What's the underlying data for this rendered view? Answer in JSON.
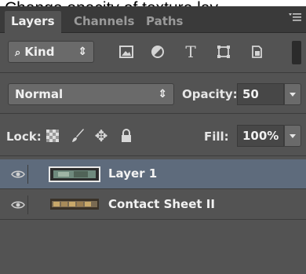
{
  "caption": "Change opacity of texture lay",
  "panel": {
    "tabs": [
      {
        "label": "Layers",
        "active": true
      },
      {
        "label": "Channels",
        "active": false
      },
      {
        "label": "Paths",
        "active": false
      }
    ],
    "menu_icon": "panel-menu-icon"
  },
  "filter": {
    "kind_label": "Kind",
    "icons": [
      "image-filter-icon",
      "adjustment-filter-icon",
      "type-filter-icon",
      "shape-filter-icon",
      "smart-object-filter-icon"
    ]
  },
  "blend": {
    "mode": "Normal",
    "opacity_label": "Opacity:",
    "opacity_value": "50"
  },
  "lock": {
    "label": "Lock:",
    "fill_label": "Fill:",
    "fill_value": "100%"
  },
  "layers": [
    {
      "name": "Layer 1",
      "visible": true,
      "selected": true
    },
    {
      "name": "Contact Sheet II",
      "visible": true,
      "selected": false
    }
  ],
  "colors": {
    "panel_bg": "#535353",
    "selected_row": "#5e6b7c"
  }
}
